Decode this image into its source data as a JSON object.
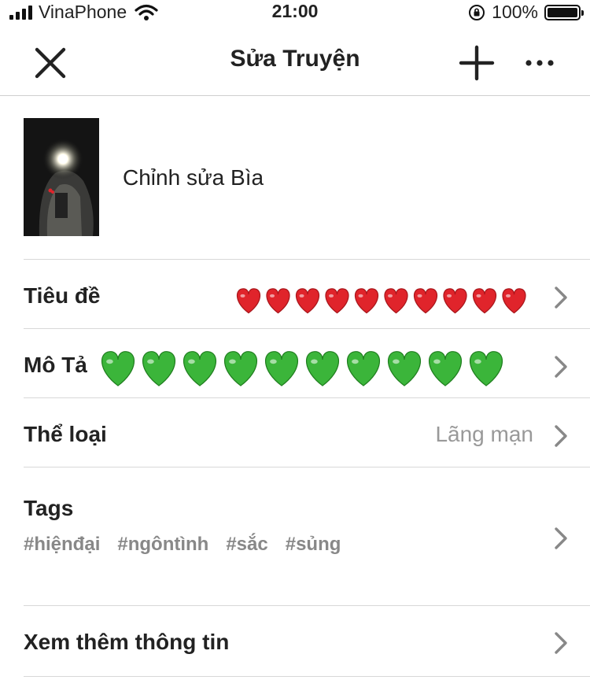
{
  "status_bar": {
    "carrier": "VinaPhone",
    "time": "21:00",
    "battery": "100%"
  },
  "header": {
    "title": "Sửa Truyện"
  },
  "cover": {
    "label": "Chỉnh sửa Bìa"
  },
  "rows": {
    "title_label": "Tiêu đề",
    "description_label": "Mô Tả",
    "genre_label": "Thể loại",
    "genre_value": "Lãng mạn",
    "tags_label": "Tags",
    "more_info_label": "Xem thêm thông tin"
  },
  "tags": [
    "#hiệnđại",
    "#ngôntình",
    "#sắc",
    "#sủng"
  ],
  "icons": {
    "close": "close-icon",
    "add": "plus-icon",
    "more": "more-icon",
    "chevron": "chevron-right-icon",
    "heart_red": "red-heart-icon",
    "heart_green": "green-heart-icon"
  },
  "colors": {
    "heart_red": "#e0242b",
    "heart_green": "#3bb53a",
    "chevron": "#888888",
    "secondary_text": "#999999"
  }
}
